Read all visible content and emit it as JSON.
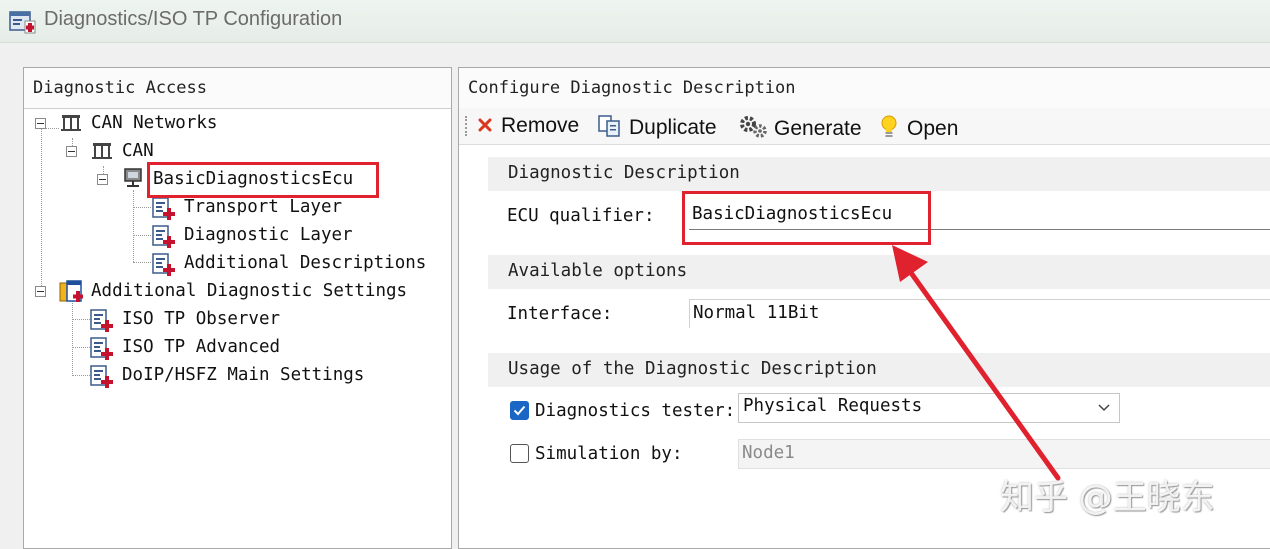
{
  "window": {
    "title": "Diagnostics/ISO TP Configuration",
    "icon": "diagnostics-config-icon"
  },
  "left_panel": {
    "header": "Diagnostic Access",
    "tree": {
      "can_networks": "CAN Networks",
      "can": "CAN",
      "ecu": "BasicDiagnosticsEcu",
      "ecu_children": [
        "Transport Layer",
        "Diagnostic Layer",
        "Additional Descriptions"
      ],
      "additional_settings": "Additional Diagnostic Settings",
      "additional_children": [
        "ISO TP Observer",
        "ISO TP Advanced",
        "DoIP/HSFZ Main Settings"
      ]
    }
  },
  "right_panel": {
    "header": "Configure Diagnostic Description",
    "toolbar": {
      "remove": "Remove",
      "duplicate": "Duplicate",
      "generate": "Generate",
      "open": "Open"
    },
    "diag_description": {
      "section_title": "Diagnostic Description",
      "ecu_qualifier_label": "ECU qualifier:",
      "ecu_qualifier_value": "BasicDiagnosticsEcu"
    },
    "available_options": {
      "section_title": "Available options",
      "interface_label": "Interface:",
      "interface_value": "Normal 11Bit"
    },
    "usage": {
      "section_title": "Usage of the Diagnostic Description",
      "tester_label": "Diagnostics tester:",
      "tester_checked": true,
      "tester_value": "Physical Requests",
      "simulation_label": "Simulation by:",
      "simulation_checked": false,
      "simulation_value": "Node1"
    }
  },
  "annotation": {
    "highlight_color": "#e0222e"
  },
  "watermark": "知乎 @王晓东"
}
